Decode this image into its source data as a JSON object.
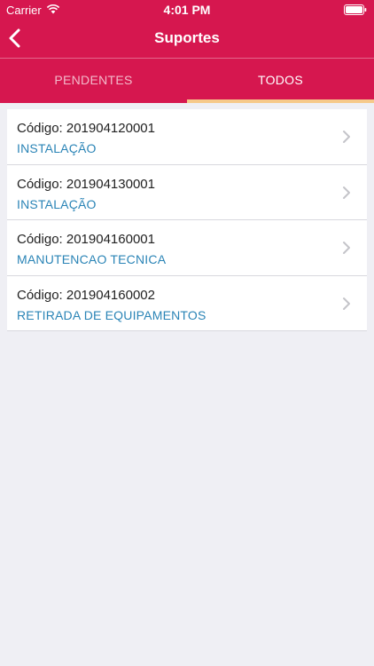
{
  "status_bar": {
    "carrier": "Carrier",
    "time": "4:01 PM"
  },
  "nav": {
    "title": "Suportes"
  },
  "tabs": [
    {
      "label": "PENDENTES",
      "active": false
    },
    {
      "label": "TODOS",
      "active": true
    }
  ],
  "colors": {
    "brand": "#d6174f",
    "tab_indicator": "#f6c98a",
    "link": "#2a84b6"
  },
  "items": [
    {
      "code_label": "Código:",
      "code": "201904120001",
      "type": "INSTALAÇÃO"
    },
    {
      "code_label": "Código:",
      "code": "201904130001",
      "type": "INSTALAÇÃO"
    },
    {
      "code_label": "Código:",
      "code": "201904160001",
      "type": "MANUTENCAO TECNICA"
    },
    {
      "code_label": "Código:",
      "code": "201904160002",
      "type": "RETIRADA DE EQUIPAMENTOS"
    }
  ]
}
